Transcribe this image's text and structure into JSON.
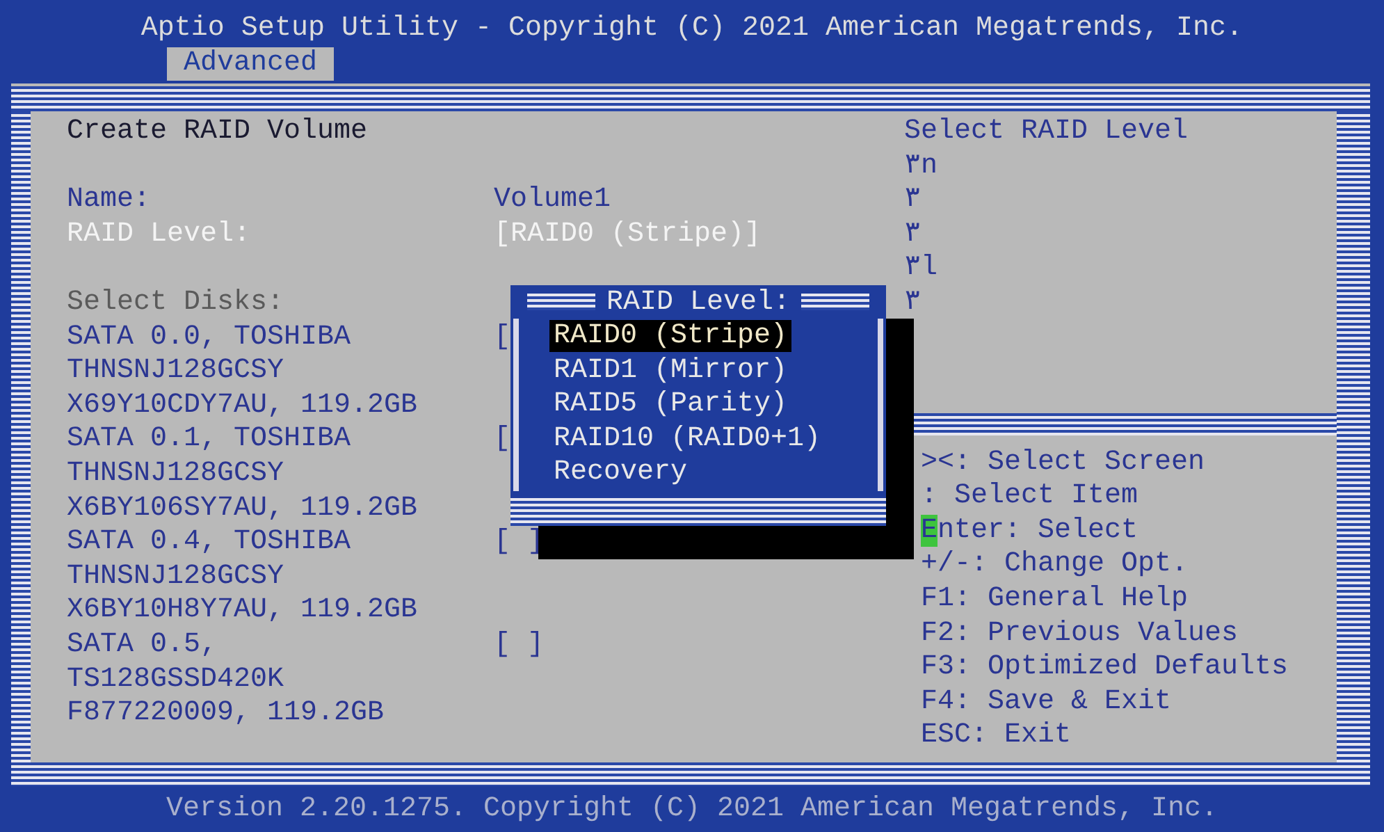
{
  "title": "Aptio Setup Utility - Copyright (C) 2021 American Megatrends, Inc.",
  "tabs": [
    {
      "label": "Advanced",
      "selected": true
    }
  ],
  "page_title": "Create RAID Volume",
  "settings": [
    {
      "label": "Name:",
      "value": "Volume1",
      "highlighted": false
    },
    {
      "label": "RAID Level:",
      "value": "[RAID0 (Stripe)]",
      "highlighted": true
    }
  ],
  "disks_heading": "Select Disks:",
  "disks": [
    {
      "lines": [
        "SATA 0.0, TOSHIBA",
        "THNSNJ128GCSY",
        "X69Y10CDY7AU, 119.2GB"
      ],
      "checkbox": "[",
      "checked": false
    },
    {
      "lines": [
        "SATA 0.1, TOSHIBA",
        "THNSNJ128GCSY",
        "X6BY106SY7AU, 119.2GB"
      ],
      "checkbox": "[",
      "checked": false
    },
    {
      "lines": [
        "SATA 0.4, TOSHIBA",
        "THNSNJ128GCSY",
        "X6BY10H8Y7AU, 119.2GB"
      ],
      "checkbox": "[ ]",
      "checked": false
    },
    {
      "lines": [
        "SATA 0.5,",
        "TS128GSSD420K",
        "F877220009, 119.2GB"
      ],
      "checkbox": "[ ]",
      "checked": false
    }
  ],
  "help_title": "Select RAID Level",
  "help_lines": [
    "٣n",
    "٣",
    "٣",
    "٣l",
    "٣"
  ],
  "keys": [
    {
      "text": "><: Select Screen",
      "cursor": false
    },
    {
      "text": ": Select Item",
      "cursor": false
    },
    {
      "text": "Enter: Select",
      "cursor": true
    },
    {
      "text": "+/-: Change Opt.",
      "cursor": false
    },
    {
      "text": "F1: General Help",
      "cursor": false
    },
    {
      "text": "F2: Previous Values",
      "cursor": false
    },
    {
      "text": "F3: Optimized Defaults",
      "cursor": false
    },
    {
      "text": "F4: Save & Exit",
      "cursor": false
    },
    {
      "text": "ESC: Exit",
      "cursor": false
    }
  ],
  "popup": {
    "title": "RAID Level:",
    "options": [
      {
        "label": "RAID0 (Stripe)",
        "selected": true
      },
      {
        "label": "RAID1 (Mirror)",
        "selected": false
      },
      {
        "label": "RAID5 (Parity)",
        "selected": false
      },
      {
        "label": "RAID10 (RAID0+1)",
        "selected": false
      },
      {
        "label": "Recovery",
        "selected": false
      }
    ]
  },
  "footer": "Version 2.20.1275. Copyright (C) 2021 American Megatrends, Inc."
}
